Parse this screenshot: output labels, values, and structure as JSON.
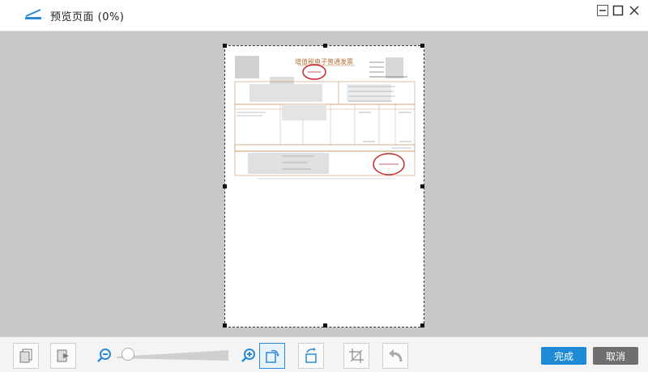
{
  "window": {
    "title": "预览页面 (0%)"
  },
  "invoice": {
    "heading": "增值税电子普通发票"
  },
  "toolbar": {
    "zoom": {
      "level": 0.05
    },
    "done_label": "完成",
    "cancel_label": "取消"
  },
  "colors": {
    "accent": "#1e8ad6",
    "cancel": "#6f6f6f",
    "stage": "#c8c8c8",
    "seal": "#c0272d"
  }
}
